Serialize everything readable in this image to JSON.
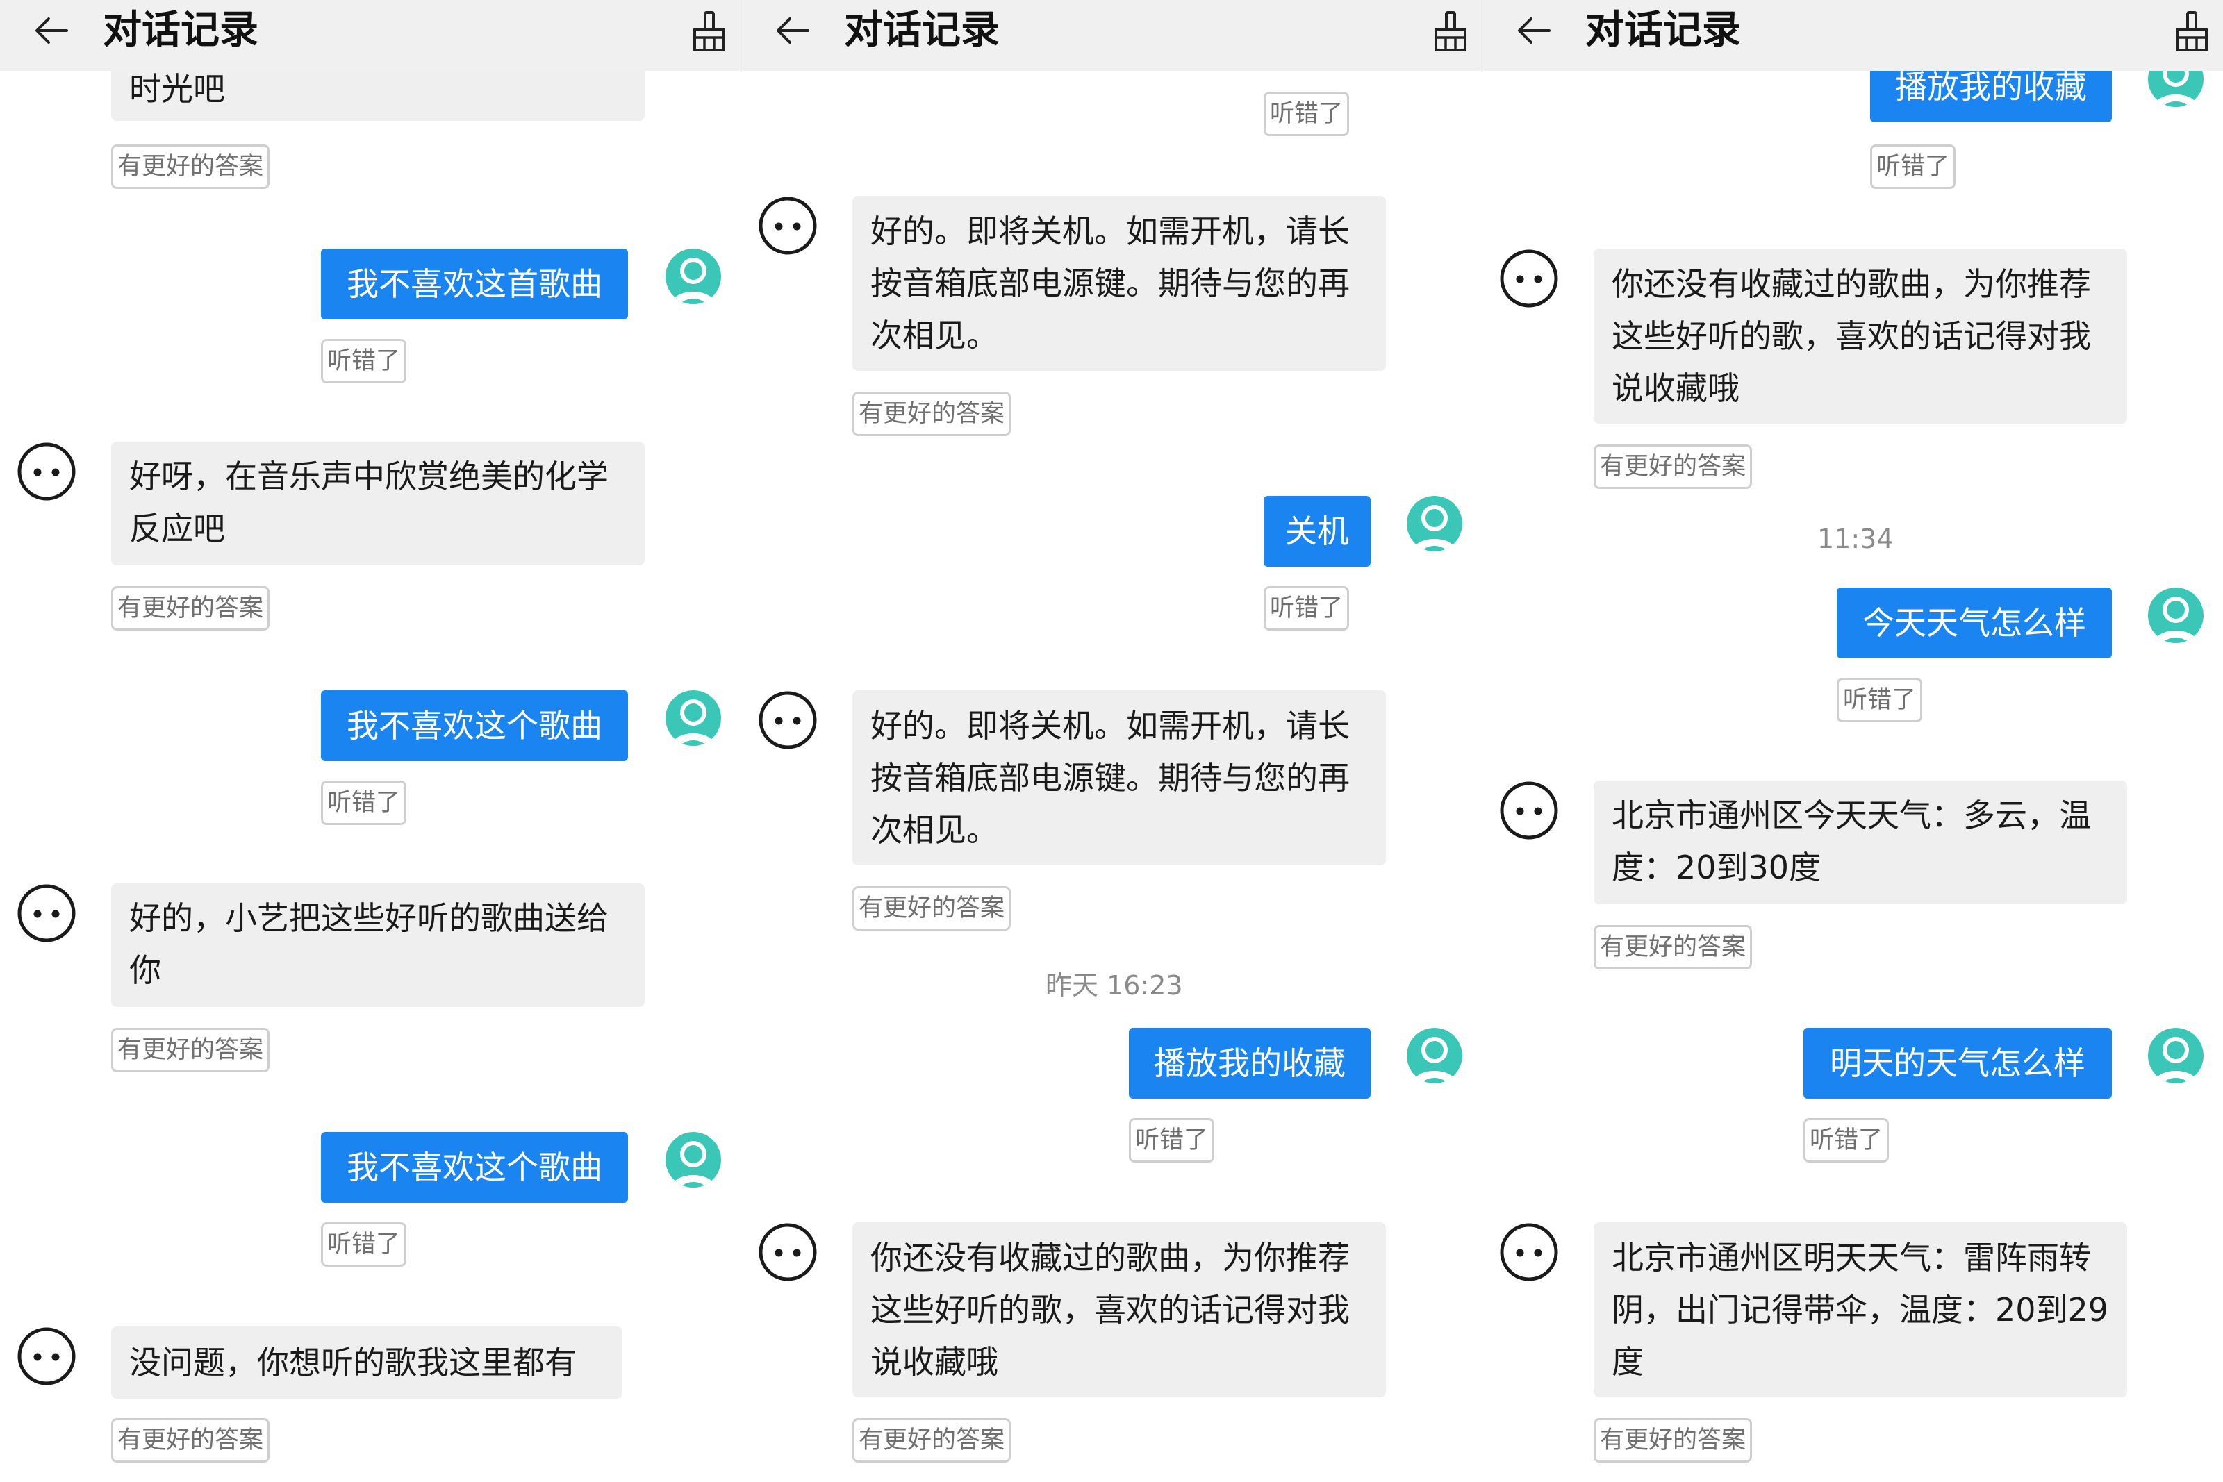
{
  "colors": {
    "user_bubble": "#1a84f0",
    "bot_bubble": "#efefef",
    "header": "#f0f0f0",
    "avatar": "#3bc7b7"
  },
  "header": {
    "title": "对话记录",
    "back_icon": "arrow-left-icon",
    "action_icon": "broom-clear-icon"
  },
  "labels": {
    "better_answer": "有更好的答案",
    "misheard": "听错了"
  },
  "panels": [
    {
      "messages": [
        {
          "role": "bot",
          "text": "时光吧"
        },
        {
          "role": "user",
          "text": "我不喜欢这首歌曲"
        },
        {
          "role": "bot",
          "text": "好呀，在音乐声中欣赏绝美的化学反应吧"
        },
        {
          "role": "user",
          "text": "我不喜欢这个歌曲"
        },
        {
          "role": "bot",
          "text": "好的，小艺把这些好听的歌曲送给你"
        },
        {
          "role": "user",
          "text": "我不喜欢这个歌曲"
        },
        {
          "role": "bot",
          "text": "没问题，你想听的歌我这里都有"
        }
      ]
    },
    {
      "messages": [
        {
          "role": "bot",
          "text": "好的。即将关机。如需开机，请长按音箱底部电源键。期待与您的再次相见。"
        },
        {
          "role": "user",
          "text": "关机"
        },
        {
          "role": "bot",
          "text": "好的。即将关机。如需开机，请长按音箱底部电源键。期待与您的再次相见。"
        },
        {
          "role": "time",
          "text": "昨天 16:23"
        },
        {
          "role": "user",
          "text": "播放我的收藏"
        },
        {
          "role": "bot",
          "text": "你还没有收藏过的歌曲，为你推荐这些好听的歌，喜欢的话记得对我说收藏哦"
        }
      ]
    },
    {
      "messages": [
        {
          "role": "user",
          "text": "播放我的收藏"
        },
        {
          "role": "bot",
          "text": "你还没有收藏过的歌曲，为你推荐这些好听的歌，喜欢的话记得对我说收藏哦"
        },
        {
          "role": "time",
          "text": "11:34"
        },
        {
          "role": "user",
          "text": "今天天气怎么样"
        },
        {
          "role": "bot",
          "text": "北京市通州区今天天气：多云，温度：20到30度"
        },
        {
          "role": "user",
          "text": "明天的天气怎么样"
        },
        {
          "role": "bot",
          "text": "北京市通州区明天天气：雷阵雨转阴，出门记得带伞，温度：20到29度"
        }
      ]
    }
  ]
}
